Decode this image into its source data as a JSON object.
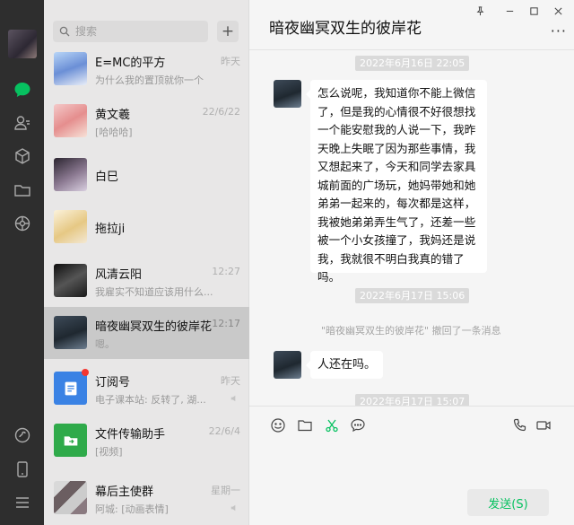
{
  "search": {
    "placeholder": "搜索"
  },
  "chat_list": [
    {
      "name": "E=MC的平方",
      "preview": "为什么我的置顶就你一个",
      "time": "昨天"
    },
    {
      "name": "黄文羲",
      "preview": "[哈哈哈]",
      "time": "22/6/22"
    },
    {
      "name": "白巳",
      "preview": "",
      "time": ""
    },
    {
      "name": "拖拉ji",
      "preview": "",
      "time": ""
    },
    {
      "name": "风清云阳",
      "preview": "我雇实不知道应该用什么...",
      "time": "12:27"
    },
    {
      "name": "暗夜幽冥双生的彼岸花",
      "preview": "嗯。",
      "time": "12:17"
    },
    {
      "name": "订阅号",
      "preview": "电子课本站: 反转了, 湖...",
      "time": "昨天"
    },
    {
      "name": "文件传输助手",
      "preview": "[视频]",
      "time": "22/6/4"
    },
    {
      "name": "幕后主使群",
      "preview": "阿城: [动画表情]",
      "time": "星期一"
    }
  ],
  "chat": {
    "title": "暗夜幽冥双生的彼岸花",
    "more": "···",
    "timestamps": [
      "2022年6月16日 22:05",
      "2022年6月17日 15:06",
      "2022年6月17日 15:07"
    ],
    "messages": [
      "怎么说呢，我知道你不能上微信了，但是我的心情很不好很想找一个能安慰我的人说一下，我昨天晚上失眠了因为那些事情，我又想起来了，今天和同学去家具城前面的广场玩，她妈带她和她弟弟一起来的，每次都是这样，我被她弟弟弄生气了，还差一些被一个小女孩撞了，我妈还是说我，我就很不明白我真的错了吗。",
      "人还在吗。"
    ],
    "recall_note": "\"暗夜幽冥双生的彼岸花\" 撤回了一条消息"
  },
  "composer": {
    "send_label": "发送(S)"
  },
  "colors": {
    "accent": "#07c160",
    "rail": "#2e2e2e",
    "unread": "#f43530"
  }
}
